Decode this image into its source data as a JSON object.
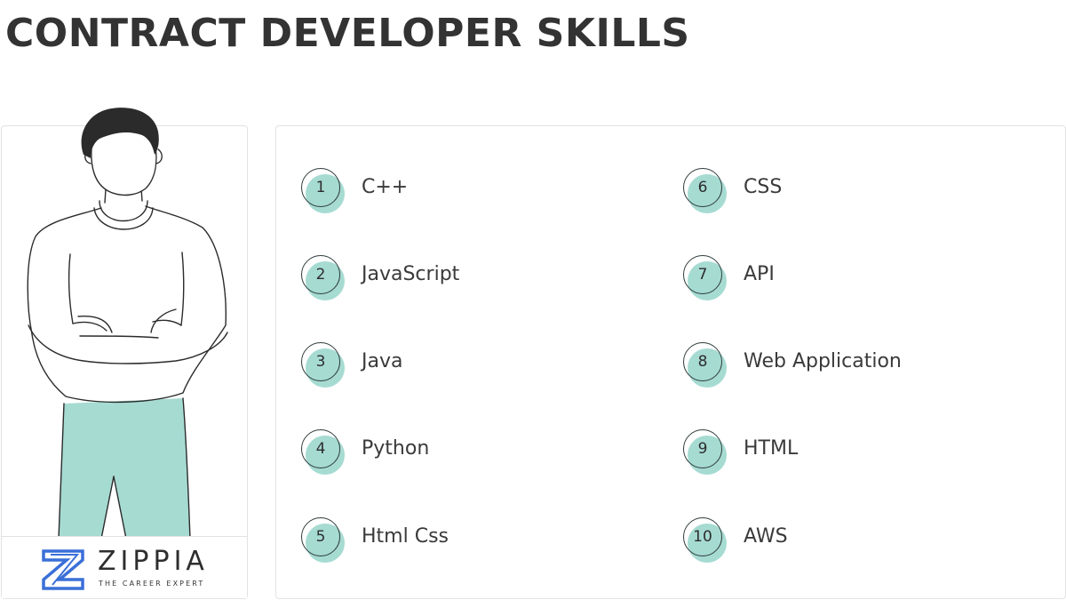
{
  "title": "CONTRACT DEVELOPER SKILLS",
  "logo": {
    "name": "ZIPPIA",
    "tagline": "THE CAREER EXPERT",
    "brand_color": "#3a6fd8"
  },
  "accent_color": "#a6dbd2",
  "skills": [
    {
      "number": "1",
      "label": "C++"
    },
    {
      "number": "2",
      "label": "JavaScript"
    },
    {
      "number": "3",
      "label": "Java"
    },
    {
      "number": "4",
      "label": "Python"
    },
    {
      "number": "5",
      "label": "Html Css"
    },
    {
      "number": "6",
      "label": "CSS"
    },
    {
      "number": "7",
      "label": "API"
    },
    {
      "number": "8",
      "label": "Web Application"
    },
    {
      "number": "9",
      "label": "HTML"
    },
    {
      "number": "10",
      "label": "AWS"
    }
  ]
}
